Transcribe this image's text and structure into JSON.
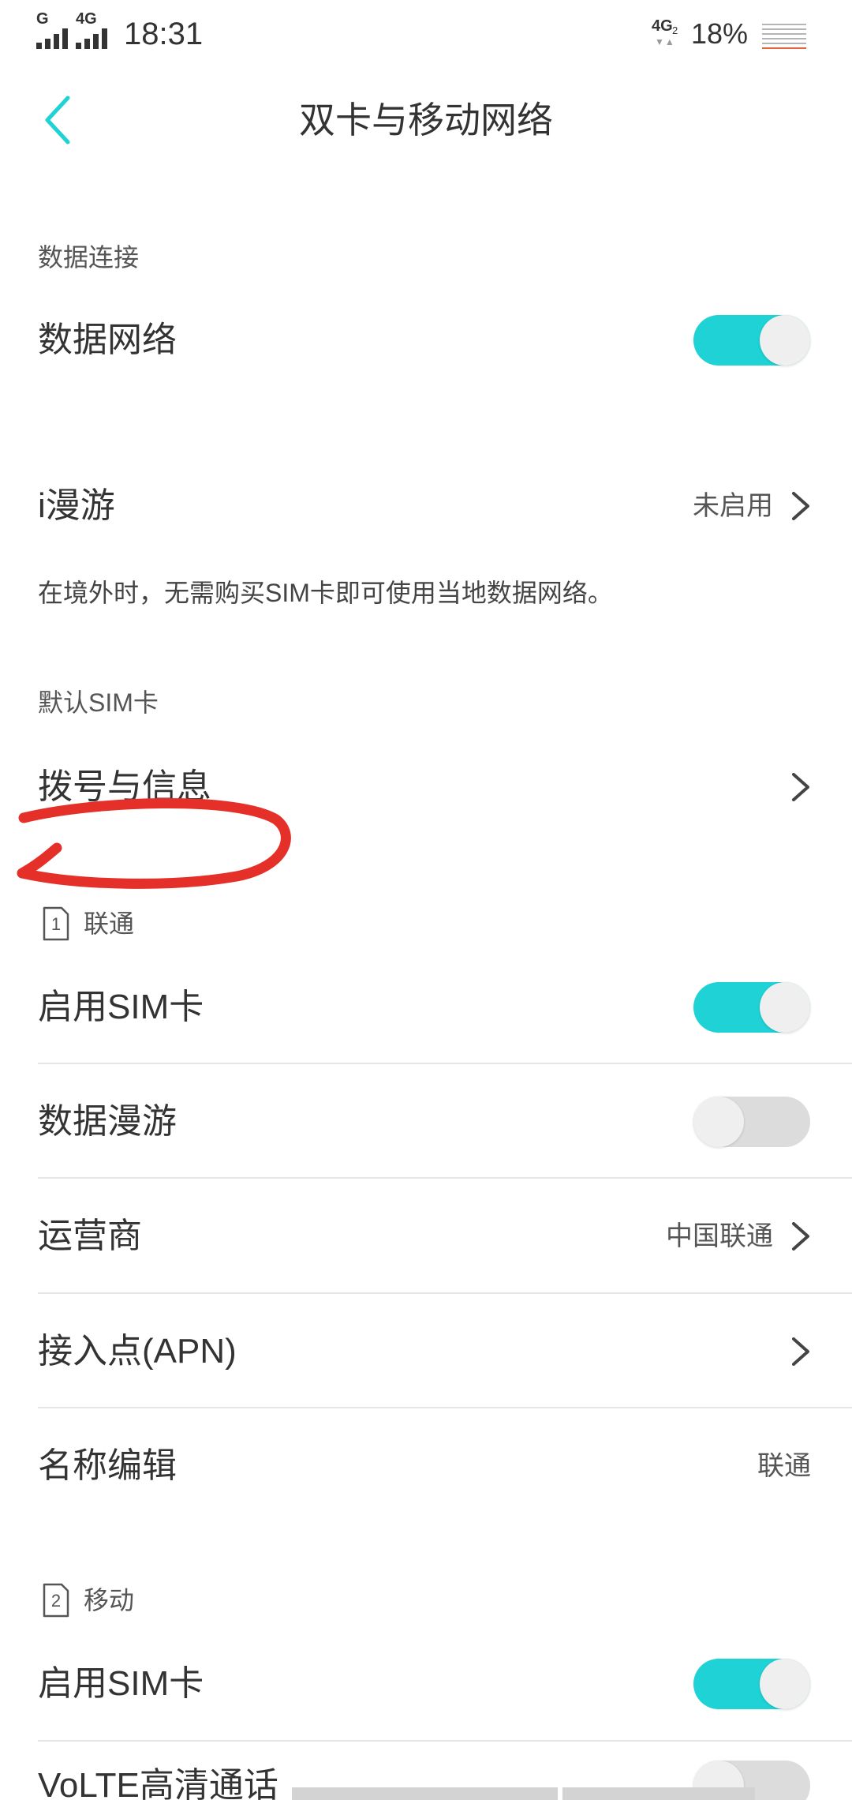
{
  "status_bar": {
    "signal1_label": "G",
    "signal2_label": "4G",
    "time": "18:31",
    "network_badge": "4G",
    "network_badge_sub": "2",
    "network_arrows": "▼▲",
    "battery": "18%"
  },
  "header": {
    "title": "双卡与移动网络"
  },
  "data_section": {
    "header": "数据连接",
    "data_network_label": "数据网络",
    "data_network_on": true,
    "iroaming_label": "i漫游",
    "iroaming_value": "未启用",
    "description": "在境外时，无需购买SIM卡即可使用当地数据网络。"
  },
  "default_sim": {
    "header": "默认SIM卡",
    "dial_msg_label": "拨号与信息"
  },
  "sim1": {
    "slot": "1",
    "name": "联通",
    "enable_label": "启用SIM卡",
    "enable_on": true,
    "data_roaming_label": "数据漫游",
    "data_roaming_on": false,
    "carrier_label": "运营商",
    "carrier_value": "中国联通",
    "apn_label": "接入点(APN)",
    "name_edit_label": "名称编辑",
    "name_edit_value": "联通"
  },
  "sim2": {
    "slot": "2",
    "name": "移动",
    "enable_label": "启用SIM卡",
    "enable_on": true,
    "volte_label": "VoLTE高清通话",
    "volte_on": false
  },
  "colors": {
    "accent": "#1ed2d6",
    "annotation": "#e5302a",
    "battery_low": "#e8643a"
  },
  "icons": {
    "back": "chevron-left-icon",
    "row_arrow": "chevron-right-icon",
    "sim": "sim-card-icon",
    "battery": "battery-icon",
    "signal": "signal-icon"
  }
}
